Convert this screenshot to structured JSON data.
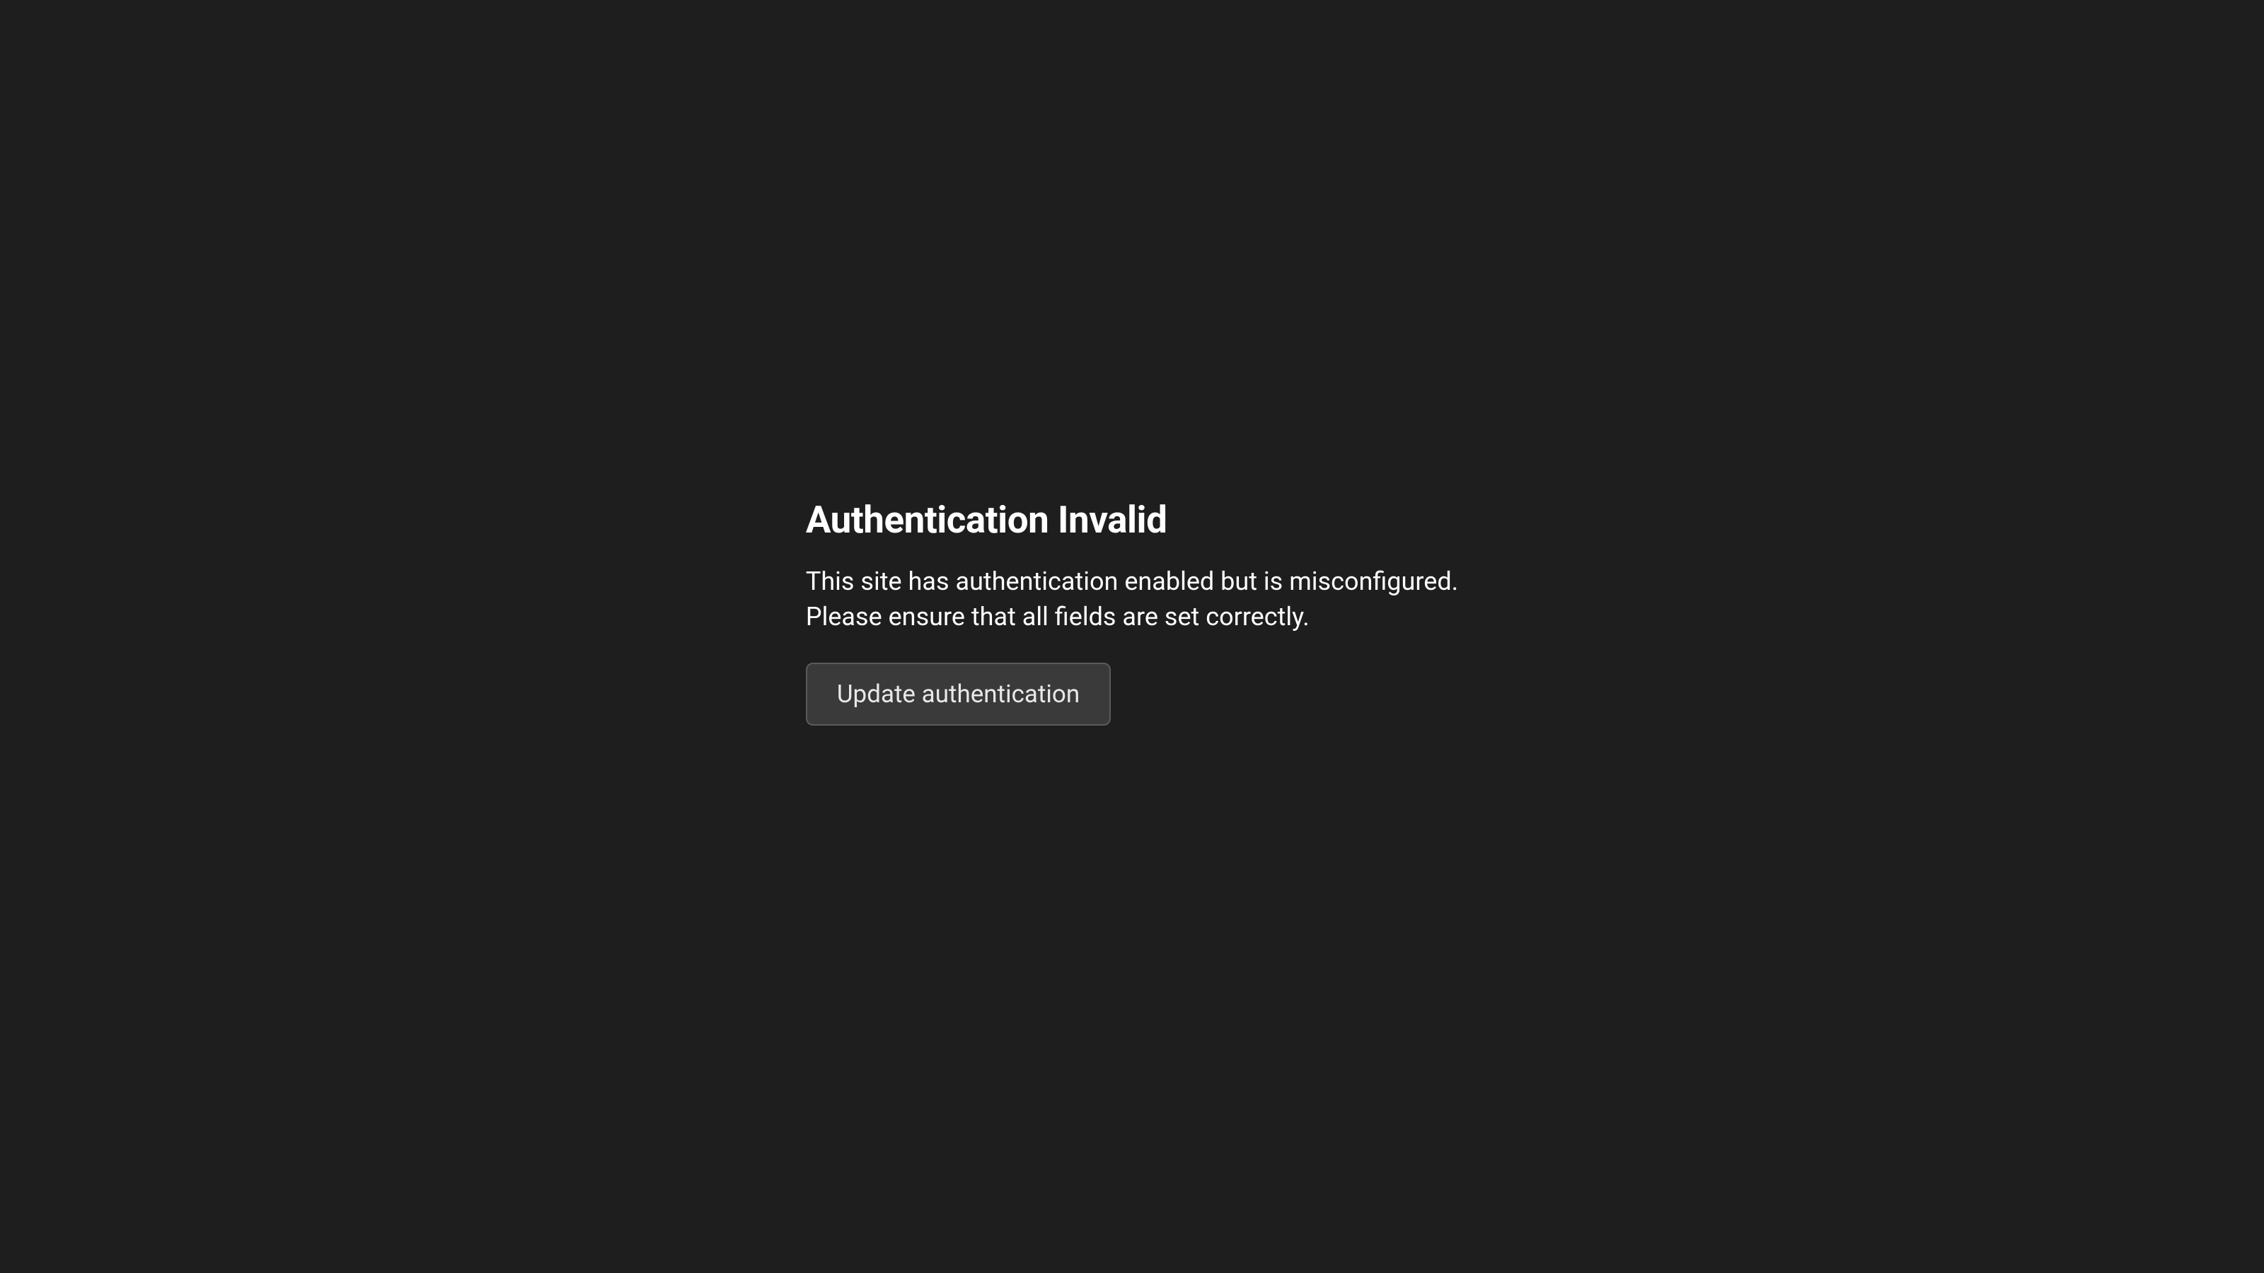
{
  "error": {
    "title": "Authentication Invalid",
    "description_line1": "This site has authentication enabled but is misconfigured.",
    "description_line2": "Please ensure that all fields are set correctly.",
    "button_label": "Update authentication"
  }
}
